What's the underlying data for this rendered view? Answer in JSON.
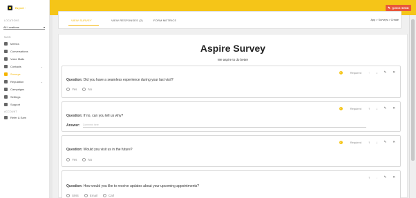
{
  "brand": {
    "name": "Ezyvet ·",
    "accent": "#f5c518",
    "alert": "#e8573b"
  },
  "sidebar": {
    "locations_label": "LOCATIONS",
    "location_value": "All Locations",
    "main_label": "MAIN",
    "items": [
      {
        "label": "Metrics",
        "icon": "metrics-icon"
      },
      {
        "label": "Conversations",
        "icon": "chat-icon"
      },
      {
        "label": "Voice Mails",
        "icon": "voicemail-icon"
      },
      {
        "label": "Contacts",
        "icon": "contacts-icon"
      },
      {
        "label": "Surveys",
        "icon": "survey-icon"
      },
      {
        "label": "Reputation",
        "icon": "star-icon"
      },
      {
        "label": "Campaigns",
        "icon": "megaphone-icon"
      },
      {
        "label": "Settings",
        "icon": "gear-icon"
      },
      {
        "label": "Support",
        "icon": "help-icon"
      }
    ],
    "account_label": "ACCOUNT",
    "account_items": [
      {
        "label": "Refer & Earn",
        "icon": "dollar-icon"
      }
    ]
  },
  "topbar": {
    "quick_send": "QUICK SEND"
  },
  "tabs": [
    {
      "label": "VIEW SURVEY"
    },
    {
      "label": "VIEW RESPONSES (2)"
    },
    {
      "label": "FORM METRICS"
    }
  ],
  "breadcrumb": "App > Surveys > Create",
  "survey": {
    "title": "Aspire Survey",
    "subtitle": "We aspire to do better",
    "required_label": "Required",
    "question_prefix": "Question:",
    "answer_prefix": "Answer:",
    "questions": [
      {
        "text": "Did you have a seamless experience during your last visit?",
        "required": true,
        "options": [
          "Yes",
          "No"
        ]
      },
      {
        "text": "If no, can you tell us why?",
        "required": true,
        "answer_placeholder": "Comment here"
      },
      {
        "text": "Would you visit us in the future?",
        "required": true,
        "options": [
          "Yes",
          "No"
        ]
      },
      {
        "text": "How would you like to receive updates about your upcoming appointments?",
        "required": false,
        "options": [
          "SMS",
          "Email",
          "Call"
        ]
      }
    ]
  }
}
